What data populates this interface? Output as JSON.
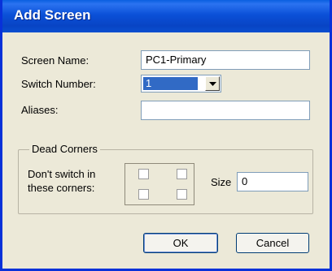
{
  "window": {
    "title": "Add Screen"
  },
  "fields": {
    "screen_name": {
      "label": "Screen Name:",
      "value": "PC1-Primary"
    },
    "switch_number": {
      "label": "Switch Number:",
      "value": "1"
    },
    "aliases": {
      "label": "Aliases:",
      "value": ""
    }
  },
  "dead_corners": {
    "legend": "Dead Corners",
    "corners_label_line1": "Don't switch in",
    "corners_label_line2": "these corners:",
    "corners": {
      "top_left": false,
      "top_right": false,
      "bottom_left": false,
      "bottom_right": false
    },
    "size_label": "Size",
    "size_value": "0"
  },
  "buttons": {
    "ok": "OK",
    "cancel": "Cancel"
  },
  "colors": {
    "title_bar": "#0a50d8",
    "dialog_bg": "#ece9d8",
    "selection": "#316ac5"
  },
  "icons": {
    "dropdown": "chevron-down-icon"
  }
}
